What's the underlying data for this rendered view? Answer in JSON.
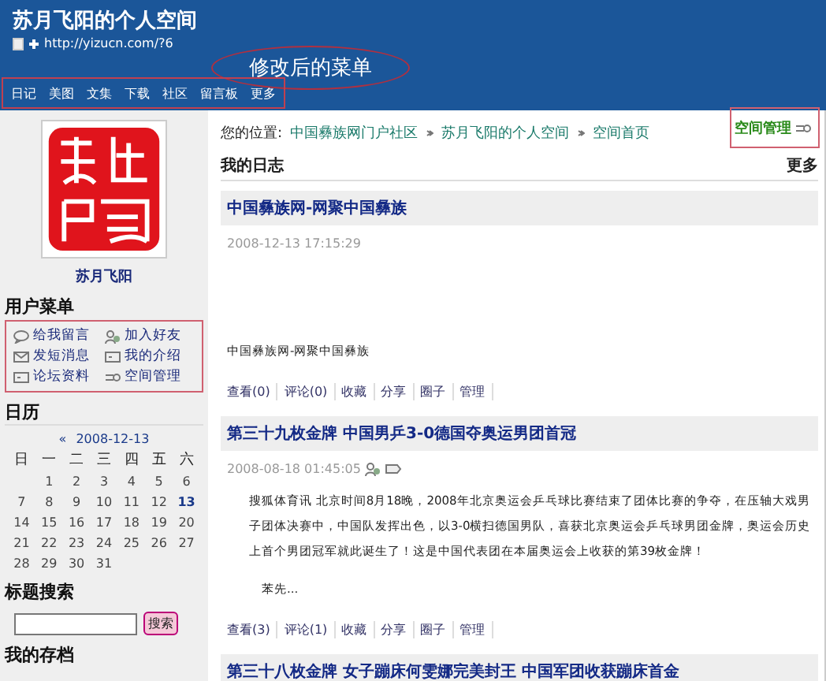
{
  "header": {
    "title": "苏月飞阳的个人空间",
    "url": "http://yizucn.com/?6",
    "annotation": "修改后的菜单"
  },
  "nav": {
    "highlighted": true,
    "items": [
      "日记",
      "美图",
      "文集",
      "下载",
      "社区",
      "留言板",
      "更多"
    ]
  },
  "sidebar": {
    "profile_name": "苏月飞阳",
    "user_menu": {
      "title": "用户菜单",
      "highlighted": true,
      "items": [
        {
          "label": "给我留言",
          "kind": "bubble"
        },
        {
          "label": "加入好友",
          "kind": "friends"
        },
        {
          "label": "发短消息",
          "kind": "mail"
        },
        {
          "label": "我的介绍",
          "kind": "card"
        },
        {
          "label": "论坛资料",
          "kind": "card"
        },
        {
          "label": "空间管理",
          "kind": "tools"
        }
      ]
    },
    "calendar": {
      "title": "日历",
      "prev": "«",
      "month": "2008-12-13",
      "weekdays": [
        "日",
        "一",
        "二",
        "三",
        "四",
        "五",
        "六"
      ],
      "weeks": [
        [
          {
            "day": "1",
            "selected": false
          },
          {
            "day": "2",
            "selected": false
          },
          {
            "day": "3",
            "selected": false
          },
          {
            "day": "4",
            "selected": false
          },
          {
            "day": "5",
            "selected": false
          },
          {
            "day": "6",
            "selected": false
          }
        ],
        [
          {
            "day": "7",
            "selected": false
          },
          {
            "day": "8",
            "selected": false
          },
          {
            "day": "9",
            "selected": false
          },
          {
            "day": "10",
            "selected": false
          },
          {
            "day": "11",
            "selected": false
          },
          {
            "day": "12",
            "selected": false
          },
          {
            "day": "13",
            "selected": true
          }
        ],
        [
          {
            "day": "14",
            "selected": false
          },
          {
            "day": "15",
            "selected": false
          },
          {
            "day": "16",
            "selected": false
          },
          {
            "day": "17",
            "selected": false
          },
          {
            "day": "18",
            "selected": false
          },
          {
            "day": "19",
            "selected": false
          },
          {
            "day": "20",
            "selected": false
          }
        ],
        [
          {
            "day": "21",
            "selected": false
          },
          {
            "day": "22",
            "selected": false
          },
          {
            "day": "23",
            "selected": false
          },
          {
            "day": "24",
            "selected": false
          },
          {
            "day": "25",
            "selected": false
          },
          {
            "day": "26",
            "selected": false
          },
          {
            "day": "27",
            "selected": false
          }
        ],
        [
          {
            "day": "28",
            "selected": false
          },
          {
            "day": "29",
            "selected": false
          },
          {
            "day": "30",
            "selected": false
          },
          {
            "day": "31",
            "selected": false
          }
        ]
      ]
    },
    "search": {
      "title": "标题搜索",
      "button": "搜索"
    },
    "archive_title": "我的存档"
  },
  "breadcrumb": {
    "label": "您的位置:",
    "items": [
      "中国彝族网门户社区",
      "苏月飞阳的个人空间",
      "空间首页"
    ]
  },
  "manage_link": {
    "label": "空间管理",
    "highlighted": true
  },
  "blog": {
    "title": "我的日志",
    "more": "更多",
    "posts": [
      {
        "title": "中国彝族网-网聚中国彝族",
        "date": "2008-12-13 17:15:29",
        "has_icons": false,
        "paragraphs": [
          "中国彝族网-网聚中国彝族"
        ],
        "actions": [
          "查看(0)",
          "评论(0)",
          "收藏",
          "分享",
          "圈子",
          "管理"
        ]
      },
      {
        "title": "第三十九枚金牌  中国男乒3-0德国夺奥运男团首冠",
        "date": "2008-08-18 01:45:05",
        "has_icons": true,
        "paragraphs": [
          "搜狐体育讯 北京时间8月18晚，2008年北京奥运会乒乓球比赛结束了团体比赛的争夺，在压轴大戏男子团体决赛中，中国队发挥出色，以3-0横扫德国男队，喜获北京奥运会乒乓球男团金牌，奥运会历史上首个男团冠军就此诞生了！这是中国代表团在本届奥运会上收获的第39枚金牌！",
          "苯先..."
        ],
        "actions": [
          "查看(3)",
          "评论(1)",
          "收藏",
          "分享",
          "圈子",
          "管理"
        ]
      },
      {
        "title": "第三十八枚金牌  女子蹦床何雯娜完美封王  中国军团收获蹦床首金"
      }
    ]
  }
}
